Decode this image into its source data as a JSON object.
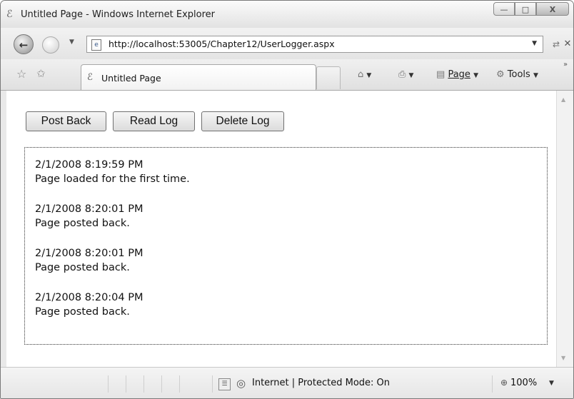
{
  "window": {
    "title": "Untitled Page - Windows Internet Explorer",
    "minimize_glyph": "—",
    "maximize_glyph": "□",
    "close_glyph": "X"
  },
  "address_bar": {
    "url": "http://localhost:53005/Chapter12/UserLogger.aspx"
  },
  "tab": {
    "label": "Untitled Page"
  },
  "command_bar": {
    "page_label": "Page",
    "tools_label": "Tools"
  },
  "page": {
    "buttons": {
      "post_back": "Post Back",
      "read_log": "Read Log",
      "delete_log": "Delete Log"
    },
    "log_entries": [
      {
        "timestamp": "2/1/2008 8:19:59 PM",
        "message": "Page loaded for the first time."
      },
      {
        "timestamp": "2/1/2008 8:20:01 PM",
        "message": "Page posted back."
      },
      {
        "timestamp": "2/1/2008 8:20:01 PM",
        "message": "Page posted back."
      },
      {
        "timestamp": "2/1/2008 8:20:04 PM",
        "message": "Page posted back."
      }
    ]
  },
  "status_bar": {
    "zone": "Internet | Protected Mode: On",
    "zoom": "100%"
  },
  "icons": [
    "ie-logo-icon",
    "back-arrow-icon",
    "forward-arrow-icon",
    "page-icon",
    "refresh-icon",
    "stop-icon",
    "favorites-star-icon",
    "add-favorites-icon",
    "home-icon",
    "print-icon",
    "page-menu-icon",
    "tools-gear-icon",
    "security-icon",
    "globe-icon",
    "zoom-icon"
  ]
}
